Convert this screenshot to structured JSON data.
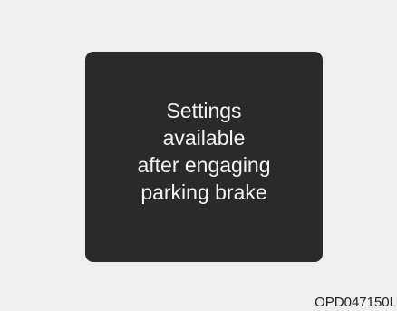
{
  "display": {
    "message_lines": [
      "Settings",
      "available",
      "after engaging",
      "parking brake"
    ]
  },
  "figure_code": "OPD047150L",
  "colors": {
    "background": "#efefef",
    "panel": "#2a2a2a",
    "text": "#f4f4f4"
  }
}
